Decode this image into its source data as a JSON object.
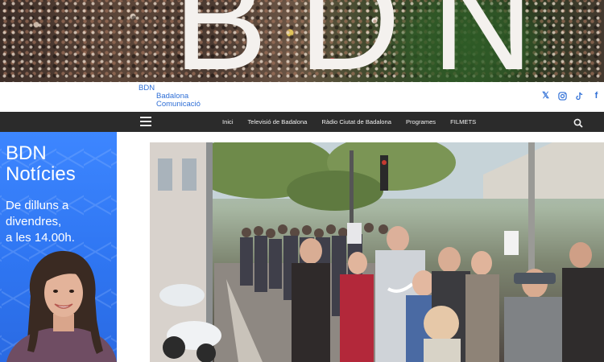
{
  "hero": {
    "letters": "BDN"
  },
  "logo": {
    "line1": "BDN",
    "line2": "Badalona",
    "line3": "Comunicació"
  },
  "social": {
    "icons": [
      "x-icon",
      "instagram-icon",
      "tiktok-icon",
      "facebook-icon"
    ],
    "x_glyph": "𝕏",
    "facebook_glyph": "f"
  },
  "nav": {
    "items": [
      "Inici",
      "Televisió de Badalona",
      "Ràdio Ciutat de Badalona",
      "Programes",
      "FILMETS"
    ]
  },
  "ad": {
    "title_line1": "BDN",
    "title_line2": "Notícies",
    "sub_line1": "De dilluns a",
    "sub_line2": "divendres,",
    "sub_line3": "a les 14.00h."
  },
  "colors": {
    "brand_blue": "#2f6fd6",
    "navbar": "#2b2b2b",
    "ad_blue": "#3d86ff"
  }
}
